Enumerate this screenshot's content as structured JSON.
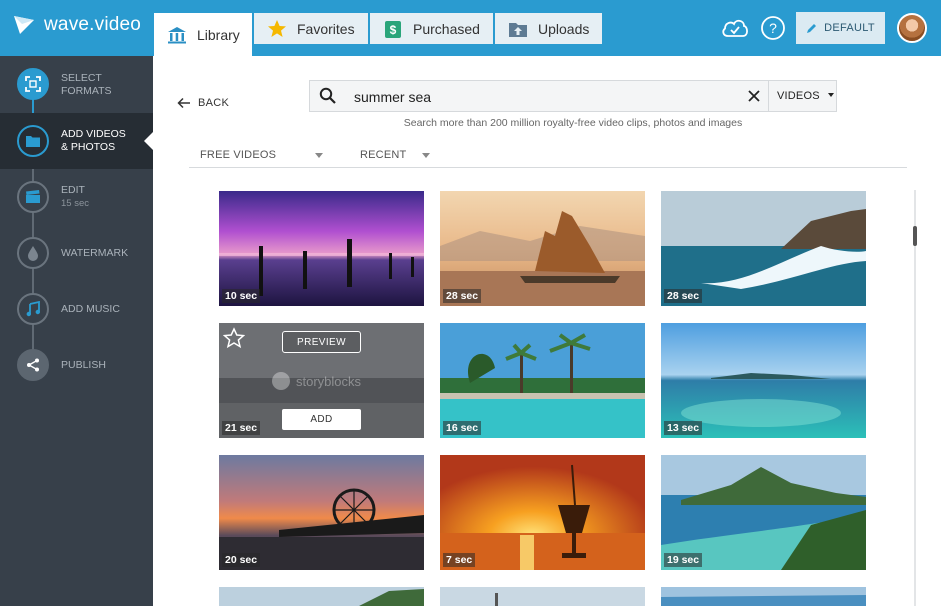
{
  "app": {
    "name": "wave.video"
  },
  "tabs": [
    {
      "label": "Library",
      "icon": "library-icon"
    },
    {
      "label": "Favorites",
      "icon": "star-icon"
    },
    {
      "label": "Purchased",
      "icon": "dollar-bag-icon"
    },
    {
      "label": "Uploads",
      "icon": "upload-folder-icon"
    }
  ],
  "header": {
    "profile_button": "DEFAULT"
  },
  "sidebar": {
    "steps": [
      {
        "label": "SELECT",
        "label2": "FORMATS",
        "sub": ""
      },
      {
        "label": "ADD VIDEOS",
        "label2": "& PHOTOS",
        "sub": ""
      },
      {
        "label": "EDIT",
        "label2": "",
        "sub": "15 sec"
      },
      {
        "label": "WATERMARK",
        "label2": "",
        "sub": ""
      },
      {
        "label": "ADD MUSIC",
        "label2": "",
        "sub": ""
      },
      {
        "label": "PUBLISH",
        "label2": "",
        "sub": ""
      }
    ]
  },
  "back_label": "BACK",
  "search": {
    "value": "summer sea",
    "type": "VIDEOS",
    "hint": "Search more than 200 million royalty-free video clips, photos and images"
  },
  "filters": {
    "license": "FREE VIDEOS",
    "sort": "RECENT"
  },
  "overlay": {
    "preview": "PREVIEW",
    "add": "ADD",
    "watermark": "storyblocks"
  },
  "results": [
    {
      "duration": "10 sec"
    },
    {
      "duration": "28 sec"
    },
    {
      "duration": "28 sec"
    },
    {
      "duration": "21 sec"
    },
    {
      "duration": "16 sec"
    },
    {
      "duration": "13 sec"
    },
    {
      "duration": "20 sec"
    },
    {
      "duration": "7 sec"
    },
    {
      "duration": "19 sec"
    }
  ],
  "colors": {
    "brand": "#2a9bd0",
    "sidebar": "#37404a",
    "sidebar_active": "#262d34"
  }
}
